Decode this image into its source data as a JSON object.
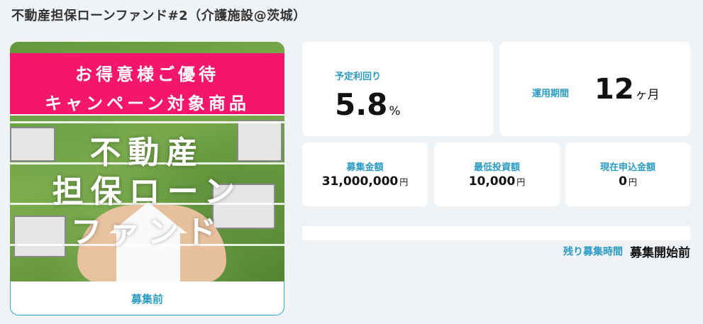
{
  "title": "不動産担保ローンファンド#2（介護施設@茨城）",
  "banner": {
    "promo_line1": "お得意様ご優待",
    "promo_line2": "キャンペーン対象商品",
    "main_line1": "不動産",
    "main_line2": "担保ローン",
    "main_line3": "ファンド",
    "status": "募集前"
  },
  "yield": {
    "label": "予定利回り",
    "value": "5.8",
    "unit": "%"
  },
  "period": {
    "label": "運用期間",
    "value": "12",
    "unit": "ヶ月"
  },
  "target_amount": {
    "label": "募集金額",
    "value": "31,000,000",
    "unit": "円"
  },
  "min_investment": {
    "label": "最低投資額",
    "value": "10,000",
    "unit": "円"
  },
  "current_applied": {
    "label": "現在申込金額",
    "value": "0",
    "unit": "円"
  },
  "progress": {
    "fraction": 0
  },
  "remaining": {
    "label": "残り募集時間",
    "value": "募集開始前"
  },
  "colors": {
    "accent": "#2b9bc4",
    "promo": "#f4166c",
    "background": "#f0f3f6"
  }
}
